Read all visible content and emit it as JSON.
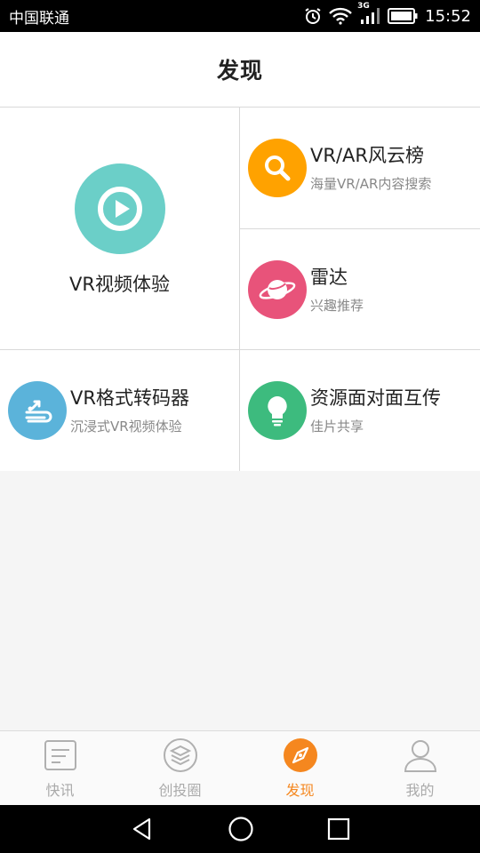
{
  "status_bar": {
    "carrier": "中国联通",
    "network_label": "3G",
    "time": "15:52",
    "icons": [
      "alarm-icon",
      "wifi-icon",
      "signal-icon",
      "battery-icon"
    ]
  },
  "header": {
    "title": "发现"
  },
  "grid": {
    "vr_video": {
      "label": "VR视频体验",
      "icon": "play-icon",
      "color": "#6BCFC8"
    },
    "ranking": {
      "title": "VR/AR风云榜",
      "subtitle": "海量VR/AR内容搜索",
      "icon": "search-icon",
      "color": "#FFA200"
    },
    "radar": {
      "title": "雷达",
      "subtitle": "兴趣推荐",
      "icon": "planet-icon",
      "color": "#E8537A"
    },
    "converter": {
      "title": "VR格式转码器",
      "subtitle": "沉浸式VR视频体验",
      "icon": "converter-icon",
      "color": "#5BB3DA"
    },
    "file_share": {
      "title": "资源面对面互传",
      "subtitle": "佳片共享",
      "icon": "lightbulb-icon",
      "color": "#3DBB7E"
    }
  },
  "bottom_nav": {
    "items": [
      {
        "label": "快讯",
        "icon": "news-icon",
        "active": false
      },
      {
        "label": "创投圈",
        "icon": "layers-icon",
        "active": false
      },
      {
        "label": "发现",
        "icon": "compass-icon",
        "active": true
      },
      {
        "label": "我的",
        "icon": "user-icon",
        "active": false
      }
    ],
    "active_color": "#F5871F"
  },
  "system_nav": {
    "icons": [
      "back-icon",
      "home-icon",
      "recents-icon"
    ]
  }
}
